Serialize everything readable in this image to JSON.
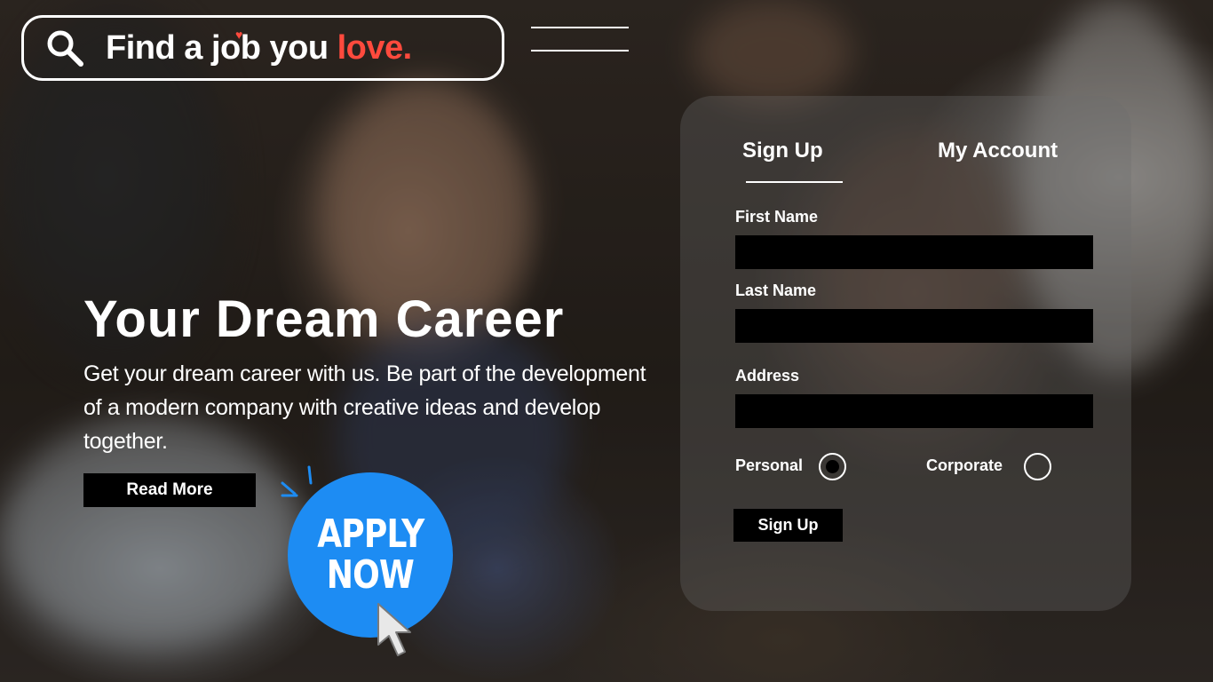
{
  "search": {
    "prefix": "Find a job you",
    "accent": "love.",
    "icon": "search-icon",
    "accent_color": "#ff4a3d"
  },
  "menu": {
    "icon": "hamburger-menu-icon"
  },
  "hero": {
    "title": "Your Dream Career",
    "description": "Get your dream career with us. Be part of the development of a modern company with creative ideas and develop together.",
    "read_more_label": "Read More"
  },
  "apply": {
    "line1": "APPLY",
    "line2": "NOW",
    "color": "#1d8cf3",
    "icon": "pointer-cursor-icon"
  },
  "form": {
    "tabs": [
      {
        "label": "Sign Up",
        "active": true
      },
      {
        "label": "My Account",
        "active": false
      }
    ],
    "first_name_label": "First Name",
    "first_name_value": "",
    "last_name_label": "Last Name",
    "last_name_value": "",
    "address_label": "Address",
    "address_value": "",
    "account_type": {
      "options": [
        "Personal",
        "Corporate"
      ],
      "selected": "Personal"
    },
    "submit_label": "Sign Up"
  }
}
